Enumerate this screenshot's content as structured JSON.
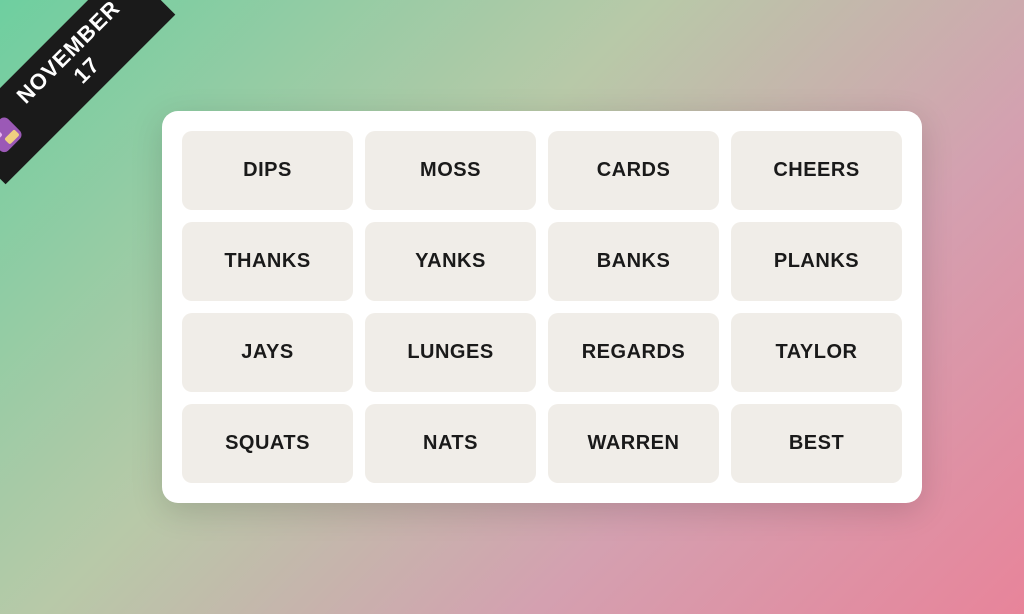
{
  "banner": {
    "date": "NOVEMBER 17",
    "app_icon_label": "app-icon"
  },
  "grid": {
    "cards": [
      {
        "id": "dips",
        "label": "DIPS"
      },
      {
        "id": "moss",
        "label": "MOSS"
      },
      {
        "id": "cards",
        "label": "CARDS"
      },
      {
        "id": "cheers",
        "label": "CHEERS"
      },
      {
        "id": "thanks",
        "label": "THANKS"
      },
      {
        "id": "yanks",
        "label": "YANKS"
      },
      {
        "id": "banks",
        "label": "BANKS"
      },
      {
        "id": "planks",
        "label": "PLANKS"
      },
      {
        "id": "jays",
        "label": "JAYS"
      },
      {
        "id": "lunges",
        "label": "LUNGES"
      },
      {
        "id": "regards",
        "label": "REGARDS"
      },
      {
        "id": "taylor",
        "label": "TAYLOR"
      },
      {
        "id": "squats",
        "label": "SQUATS"
      },
      {
        "id": "nats",
        "label": "NATS"
      },
      {
        "id": "warren",
        "label": "WARREN"
      },
      {
        "id": "best",
        "label": "BEST"
      }
    ]
  }
}
